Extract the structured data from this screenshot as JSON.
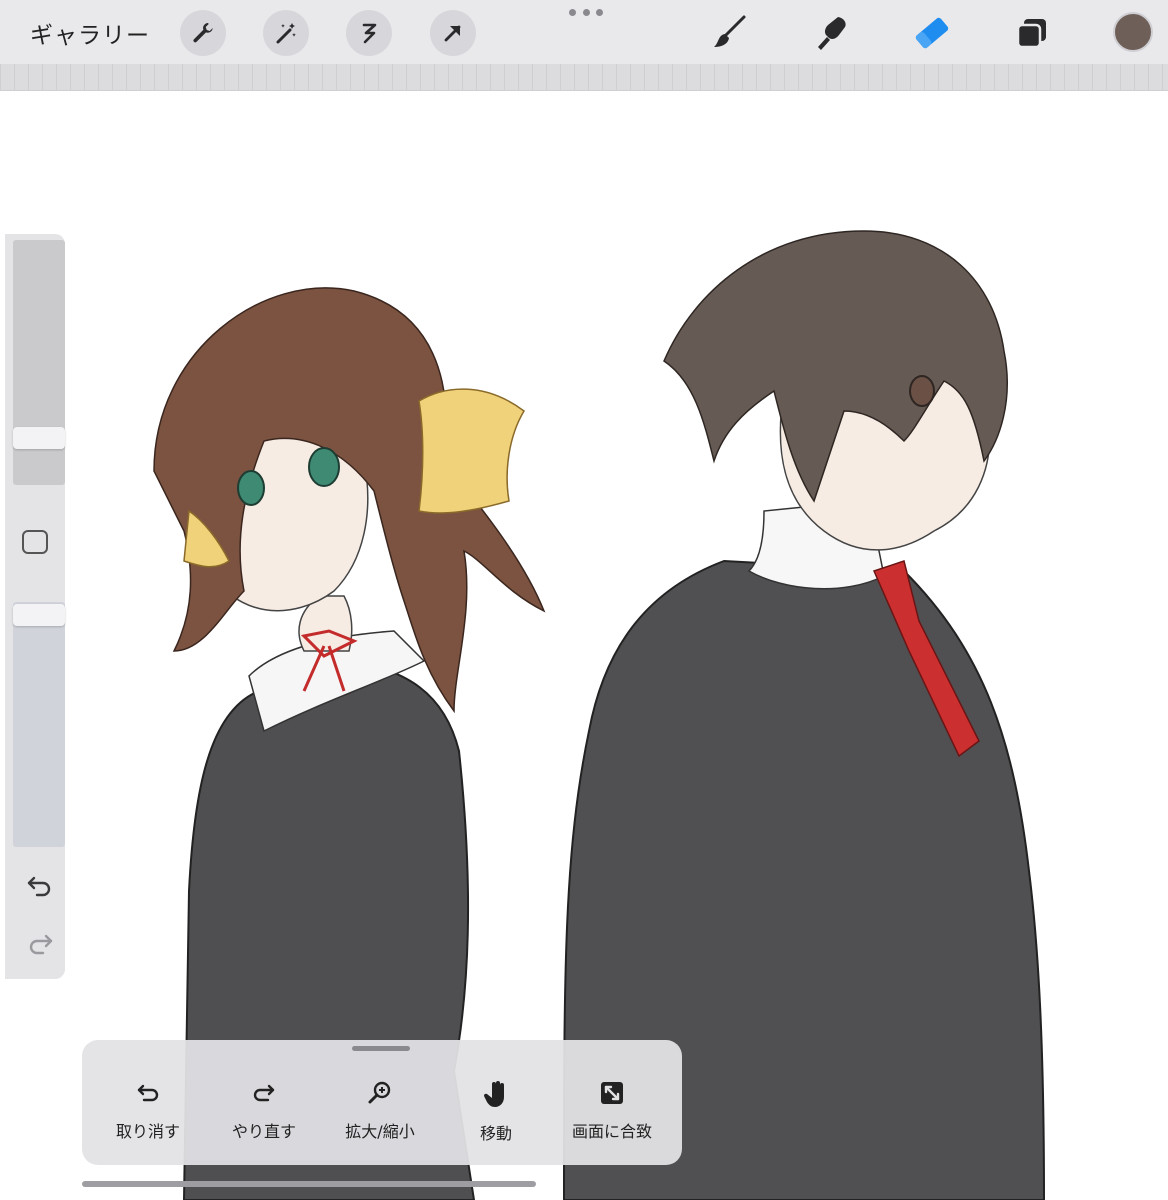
{
  "toolbar": {
    "gallery_label": "ギャラリー",
    "left_tools": [
      {
        "icon": "wrench-icon"
      },
      {
        "icon": "magic-wand-icon"
      },
      {
        "icon": "selection-icon"
      },
      {
        "icon": "arrow-transform-icon"
      }
    ],
    "right_tools": [
      {
        "icon": "brush-icon"
      },
      {
        "icon": "smudge-icon"
      },
      {
        "icon": "eraser-icon",
        "active": true
      },
      {
        "icon": "layers-icon"
      }
    ],
    "current_color": "#6e6058",
    "accent_color": "#1f8cf0"
  },
  "quickmenu": {
    "items": [
      {
        "label": "取り消す",
        "icon": "undo-icon"
      },
      {
        "label": "やり直す",
        "icon": "redo-icon"
      },
      {
        "label": "拡大/縮小",
        "icon": "zoom-icon"
      },
      {
        "label": "移動",
        "icon": "hand-icon"
      },
      {
        "label": "画面に合致",
        "icon": "fit-screen-icon"
      }
    ]
  }
}
